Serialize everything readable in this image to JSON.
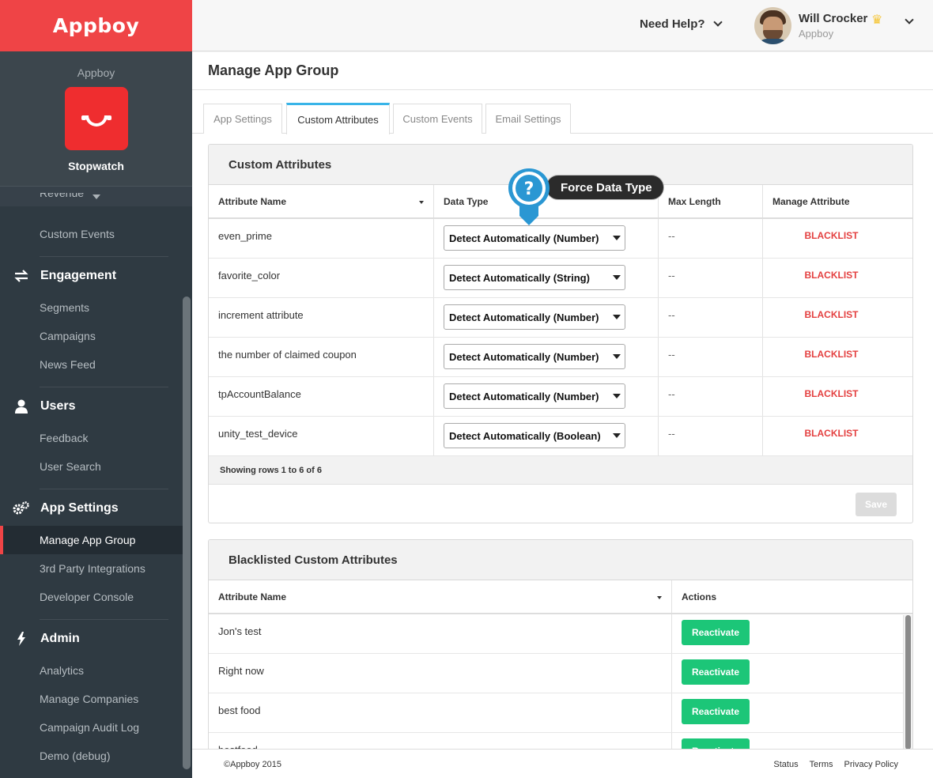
{
  "brand": "Appboy",
  "app": {
    "company": "Appboy",
    "name": "Stopwatch"
  },
  "nav": {
    "pre_items": [
      "Revenue",
      "Custom Events"
    ],
    "sections": [
      {
        "title": "Engagement",
        "icon": "swap-arrows-icon",
        "items": [
          "Segments",
          "Campaigns",
          "News Feed"
        ]
      },
      {
        "title": "Users",
        "icon": "user-icon",
        "items": [
          "Feedback",
          "User Search"
        ]
      },
      {
        "title": "App Settings",
        "icon": "gears-icon",
        "items": [
          "Manage App Group",
          "3rd Party Integrations",
          "Developer Console"
        ],
        "active": "Manage App Group"
      },
      {
        "title": "Admin",
        "icon": "lightning-icon",
        "items": [
          "Analytics",
          "Manage Companies",
          "Campaign Audit Log",
          "Demo (debug)"
        ]
      }
    ]
  },
  "topbar": {
    "help": "Need Help?",
    "user_name": "Will Crocker",
    "user_org": "Appboy"
  },
  "page_title": "Manage App Group",
  "tabs": [
    "App Settings",
    "Custom Attributes",
    "Custom Events",
    "Email Settings"
  ],
  "active_tab": "Custom Attributes",
  "custom_attributes": {
    "title": "Custom Attributes",
    "columns": [
      "Attribute Name",
      "Data Type",
      "Max Length",
      "Manage Attribute"
    ],
    "rows": [
      {
        "name": "even_prime",
        "type": "Detect Automatically (Number)",
        "max": "--",
        "action": "BLACKLIST"
      },
      {
        "name": "favorite_color",
        "type": "Detect Automatically (String)",
        "max": "--",
        "action": "BLACKLIST"
      },
      {
        "name": "increment attribute",
        "type": "Detect Automatically (Number)",
        "max": "--",
        "action": "BLACKLIST"
      },
      {
        "name": "the number of claimed coupon",
        "type": "Detect Automatically (Number)",
        "max": "--",
        "action": "BLACKLIST"
      },
      {
        "name": "tpAccountBalance",
        "type": "Detect Automatically (Number)",
        "max": "--",
        "action": "BLACKLIST"
      },
      {
        "name": "unity_test_device",
        "type": "Detect Automatically (Boolean)",
        "max": "--",
        "action": "BLACKLIST"
      }
    ],
    "footer": "Showing rows 1 to 6 of 6",
    "save": "Save"
  },
  "tooltip": "Force Data Type",
  "blacklisted": {
    "title": "Blacklisted Custom Attributes",
    "columns": [
      "Attribute Name",
      "Actions"
    ],
    "rows": [
      {
        "name": "Jon's test",
        "action": "Reactivate"
      },
      {
        "name": "Right now",
        "action": "Reactivate"
      },
      {
        "name": "best food",
        "action": "Reactivate"
      },
      {
        "name": "bestfood",
        "action": "Reactivate"
      }
    ]
  },
  "footer": {
    "copyright": "©Appboy 2015",
    "links": [
      "Status",
      "Terms",
      "Privacy Policy"
    ]
  },
  "colors": {
    "brand_red": "#ef4446",
    "accent_blue": "#38b4e8",
    "reactivate_green": "#1cc678",
    "blacklist_red": "#e44040"
  }
}
